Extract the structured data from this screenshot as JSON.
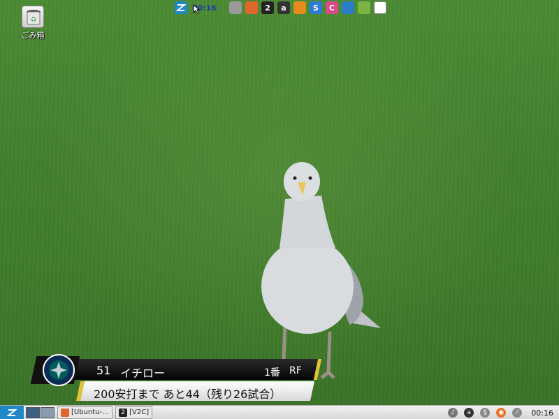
{
  "desktop": {
    "trash_label": "ごみ箱"
  },
  "top_dock": {
    "clock": "00:16",
    "apps": [
      {
        "icon": "zorin-icon",
        "color": "#1e88c9",
        "glyph": ""
      },
      {
        "icon": "drive-icon",
        "color": "#9a9a9a",
        "glyph": ""
      },
      {
        "icon": "firefox-icon",
        "color": "#e0662a",
        "glyph": ""
      },
      {
        "icon": "v2c-icon",
        "color": "#222222",
        "glyph": "2"
      },
      {
        "icon": "amazon-icon",
        "color": "#333333",
        "glyph": "a"
      },
      {
        "icon": "vlc-icon",
        "color": "#e78a1c",
        "glyph": ""
      },
      {
        "icon": "synaptic-icon",
        "color": "#2f7bd6",
        "glyph": "S"
      },
      {
        "icon": "paint-icon",
        "color": "#d94a8a",
        "glyph": "C"
      },
      {
        "icon": "network-icon",
        "color": "#2b7cc9",
        "glyph": ""
      },
      {
        "icon": "android-icon",
        "color": "#7cb342",
        "glyph": ""
      },
      {
        "icon": "window-icon",
        "color": "#ffffff",
        "glyph": ""
      }
    ]
  },
  "score_graphic": {
    "player_number": "51",
    "player_name": "イチロー",
    "batting_order": "1番",
    "position": "RF",
    "caption": "200安打まで あと44（残り26試合）",
    "accent_color": "#e0c23a"
  },
  "taskbar": {
    "tasks": [
      {
        "label": "[Ubuntu-…",
        "icon": "firefox-icon",
        "glyph": ""
      },
      {
        "label": "[V2C]",
        "icon": "v2c-icon",
        "glyph": "2"
      }
    ],
    "tray_icons": [
      {
        "icon": "volume-icon",
        "color": "#777777",
        "glyph": "♪"
      },
      {
        "icon": "amazon-tray-icon",
        "color": "#333333",
        "glyph": "a"
      },
      {
        "icon": "updates-icon",
        "color": "#8a8a8a",
        "glyph": "§"
      },
      {
        "icon": "ubuntu-one-icon",
        "color": "#e8742a",
        "glyph": "◉"
      },
      {
        "icon": "network-tray-icon",
        "color": "#8a8a8a",
        "glyph": "⁄"
      }
    ],
    "clock": "00:16"
  }
}
